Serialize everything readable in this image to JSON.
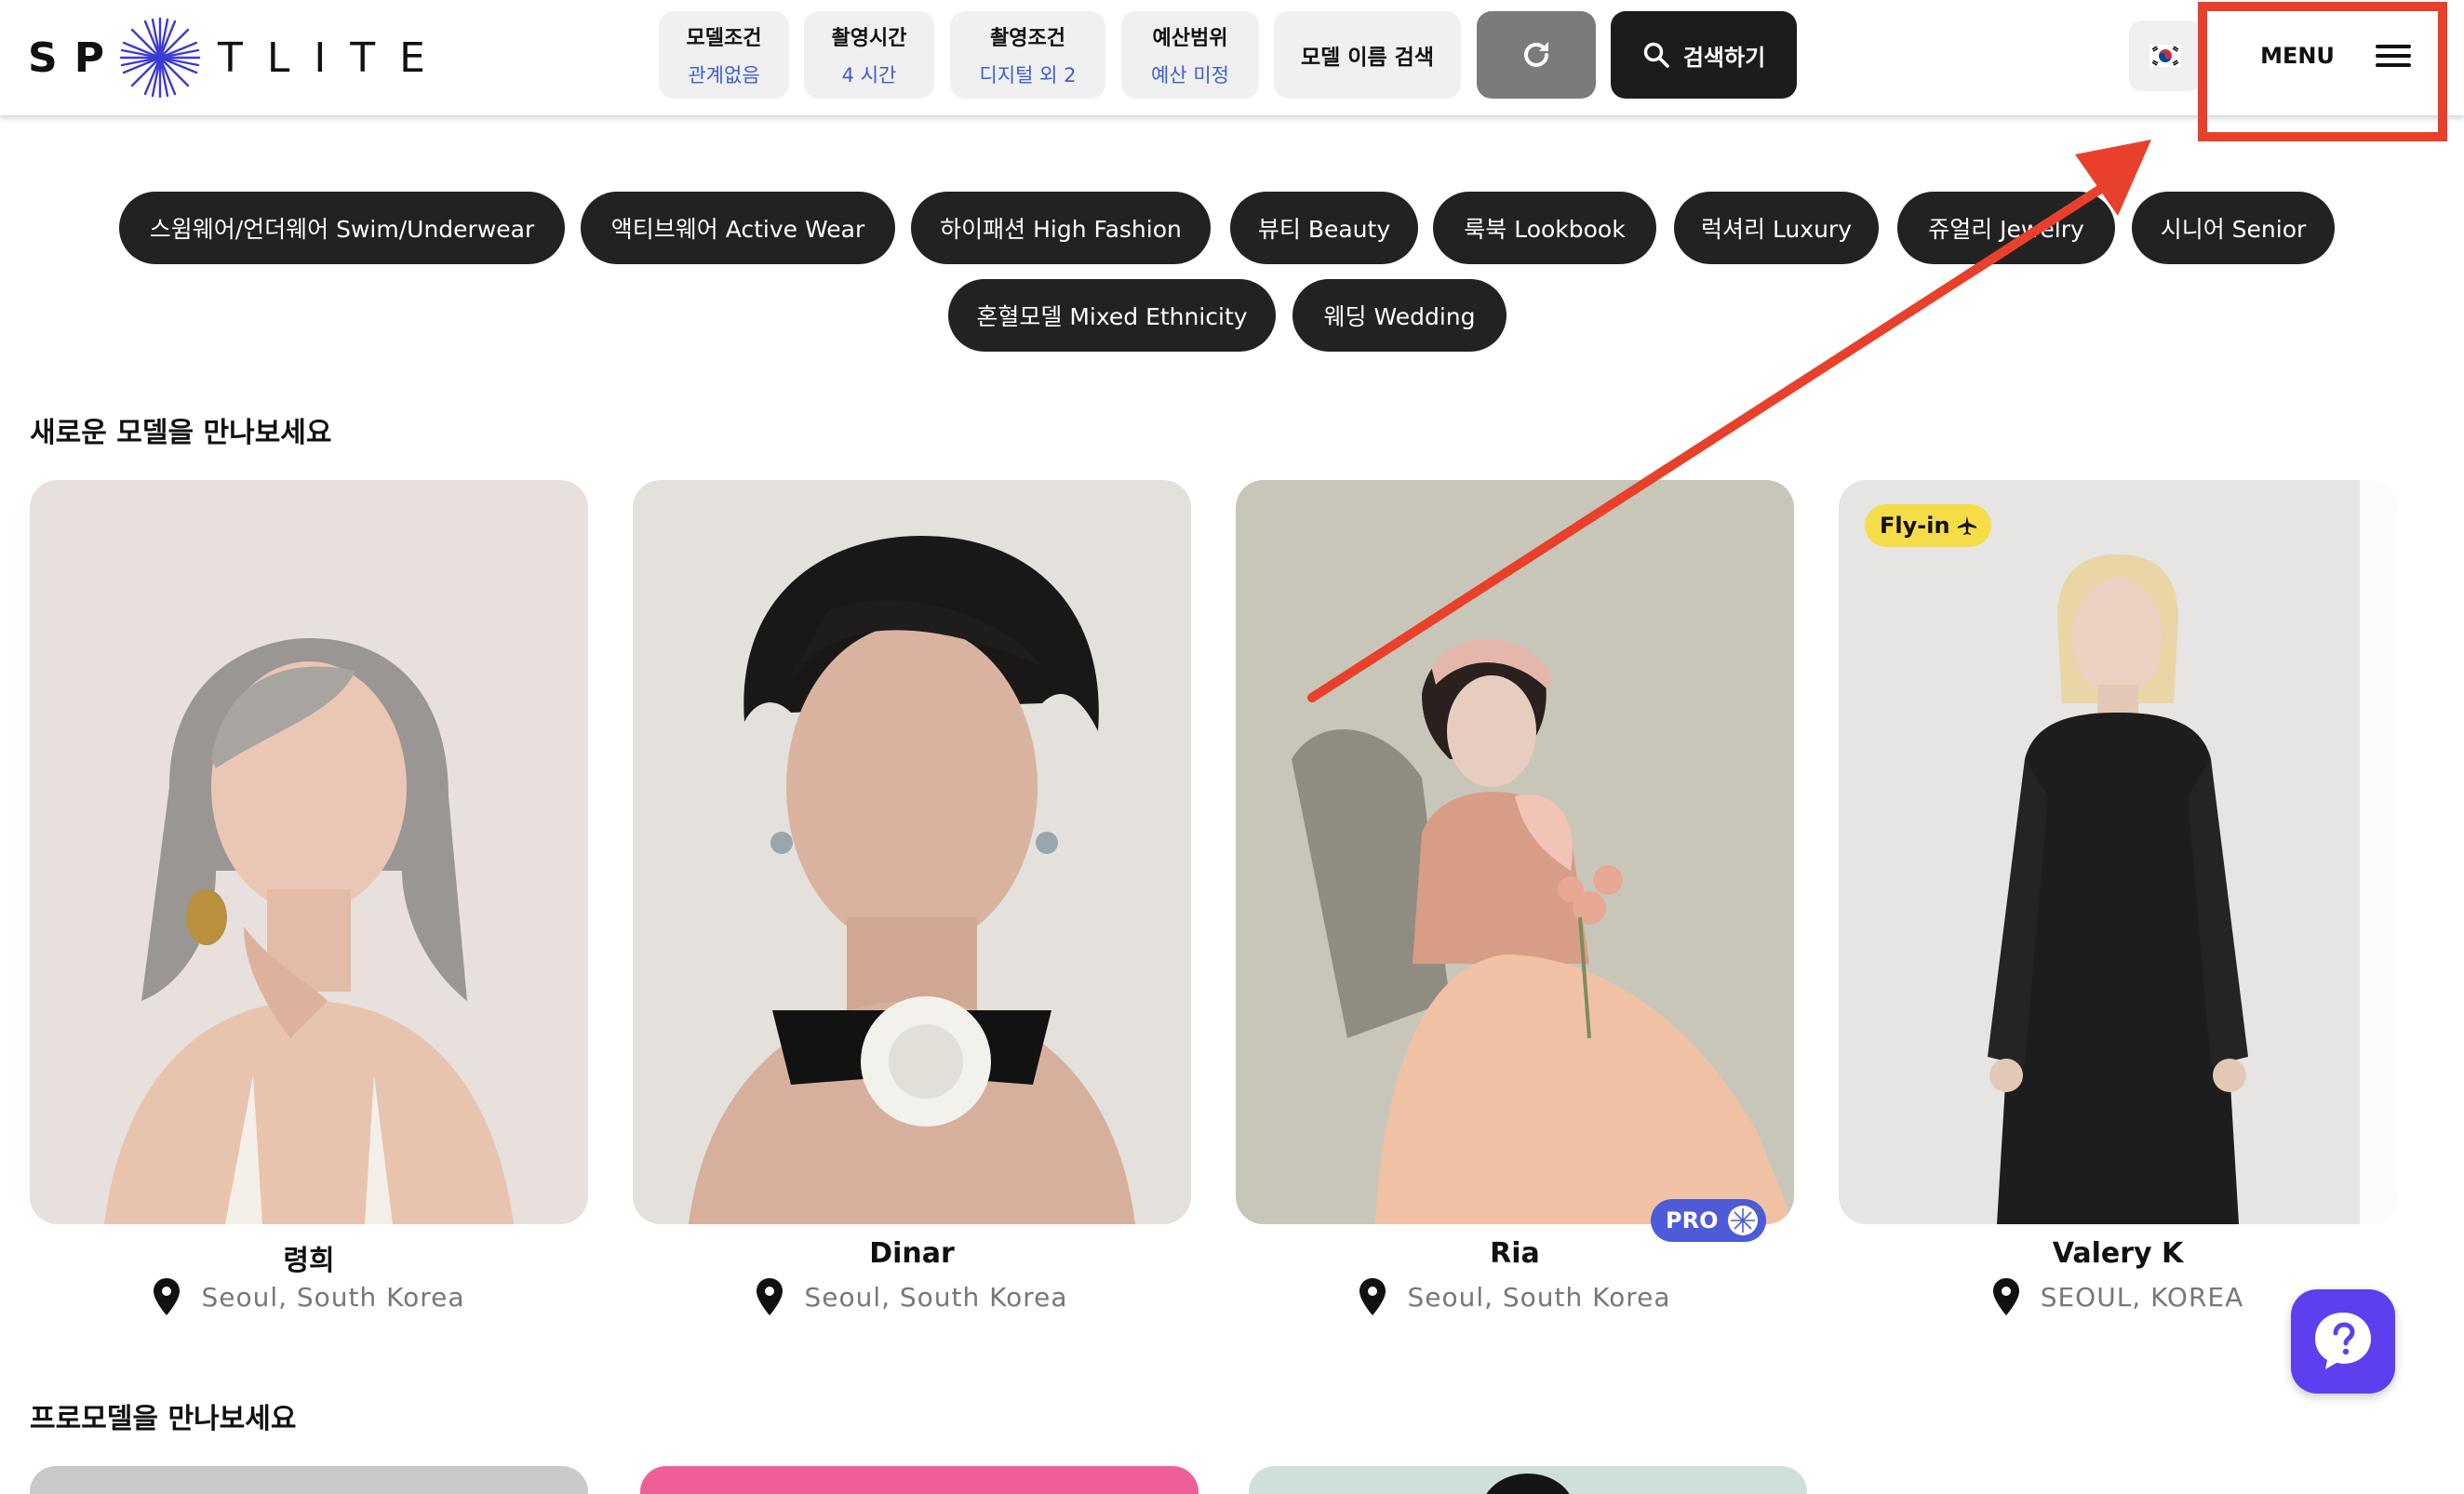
{
  "brand": {
    "left": "SP",
    "right": "TLITE"
  },
  "filters": [
    {
      "title": "모델조건",
      "value": "관계없음"
    },
    {
      "title": "촬영시간",
      "value": "4 시간"
    },
    {
      "title": "촬영조건",
      "value": "디지털 외 2"
    },
    {
      "title": "예산범위",
      "value": "예산 미정"
    }
  ],
  "name_search_label": "모델 이름 검색",
  "search_button_label": "검색하기",
  "menu_label": "MENU",
  "categories": [
    "스윔웨어/언더웨어 Swim/Underwear",
    "액티브웨어 Active Wear",
    "하이패션 High Fashion",
    "뷰티 Beauty",
    "룩북 Lookbook",
    "럭셔리 Luxury",
    "쥬얼리 Jewelry",
    "시니어 Senior",
    "혼혈모델 Mixed Ethnicity",
    "웨딩 Wedding"
  ],
  "sections": {
    "new_models": "새로운 모델을 만나보세요",
    "pro_models": "프로모델을 만나보세요"
  },
  "models": [
    {
      "name": "령희",
      "location": "Seoul, South Korea"
    },
    {
      "name": "Dinar",
      "location": "Seoul, South Korea"
    },
    {
      "name": "Ria",
      "location": "Seoul, South Korea",
      "badge": "PRO"
    },
    {
      "name": "Valery K",
      "location": "SEOUL, KOREA",
      "badge": "Fly-in"
    }
  ],
  "colors": {
    "accent_blue": "#3c5cd6",
    "pill_bg": "#222222",
    "annotation_red": "#e8402a",
    "help_purple": "#5d3ff0",
    "fly_in_yellow": "#f7dc4a",
    "pro_blue": "#4d5bd8"
  },
  "icons": [
    "spotlight-star-icon",
    "refresh-icon",
    "search-icon",
    "korea-flag-icon",
    "hamburger-icon",
    "location-pin-icon",
    "airplane-icon",
    "help-question-icon"
  ]
}
